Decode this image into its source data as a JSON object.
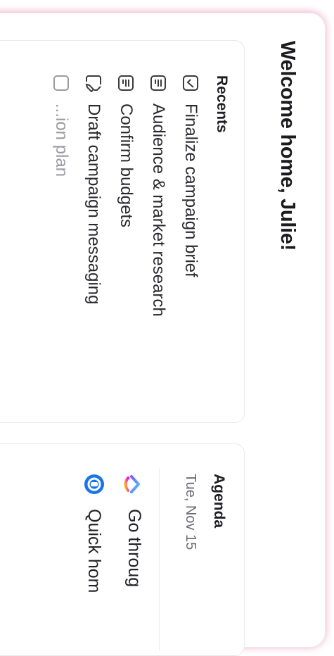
{
  "header": {
    "welcome": "Welcome home, Julie!"
  },
  "recents": {
    "title": "Recents",
    "items": [
      {
        "label": "Finalize campaign brief",
        "icon": "task-check-icon"
      },
      {
        "label": "Audience & market research",
        "icon": "doc-icon"
      },
      {
        "label": "Confirm budgets",
        "icon": "doc-icon"
      },
      {
        "label": "Draft campaign messaging",
        "icon": "edit-doc-icon"
      },
      {
        "label": "...ion plan",
        "icon": "doc-icon"
      }
    ]
  },
  "agenda": {
    "title": "Agenda",
    "date": "Tue, Nov 15",
    "items": [
      {
        "label": "Go throug",
        "icon": "clickup-logo-icon"
      },
      {
        "label": "Quick hom",
        "icon": "meeting-icon"
      }
    ]
  },
  "colors": {
    "accent_pink": "#ec78aa",
    "logo_blue": "#1a73e8"
  }
}
